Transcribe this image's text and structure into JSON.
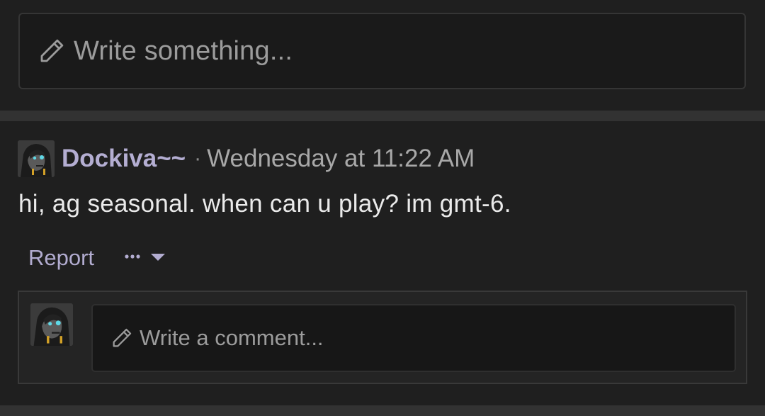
{
  "composer": {
    "placeholder": "Write something...",
    "icon": "pencil-icon"
  },
  "post": {
    "author": "Dockiva~~",
    "separator": "·",
    "timestamp": "Wednesday at 11:22 AM",
    "body": "hi, ag seasonal. when can u play? im gmt-6.",
    "actions": {
      "report_label": "Report",
      "more_icon": "ellipsis-dropdown-icon"
    }
  },
  "comment": {
    "placeholder": "Write a comment...",
    "icon": "pencil-icon"
  },
  "colors": {
    "background": "#1f1f1f",
    "author": "#b4aed2",
    "link": "#b2acd0",
    "text": "#eaeaea",
    "muted": "#a8a8a8"
  }
}
